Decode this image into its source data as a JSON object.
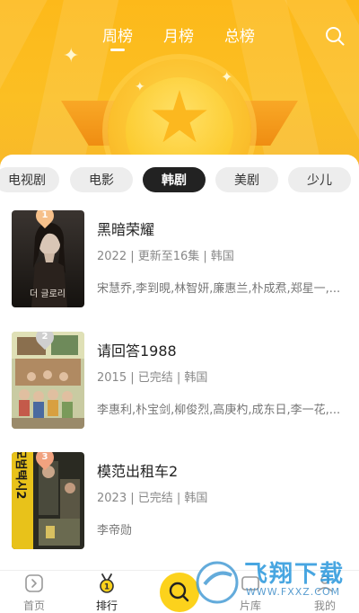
{
  "top_tabs": [
    {
      "label": "周榜",
      "active": true
    },
    {
      "label": "月榜",
      "active": false
    },
    {
      "label": "总榜",
      "active": false
    }
  ],
  "categories": [
    {
      "label": "电视剧",
      "active": false
    },
    {
      "label": "电影",
      "active": false
    },
    {
      "label": "韩剧",
      "active": true
    },
    {
      "label": "美剧",
      "active": false
    },
    {
      "label": "少儿",
      "active": false
    }
  ],
  "items": [
    {
      "rank": "1",
      "title": "黑暗荣耀",
      "meta": "2022 | 更新至16集 | 韩国",
      "cast": "宋慧乔,李到晛,林智妍,廉惠兰,朴成焄,郑星一,...",
      "poster_text": "더 글로리"
    },
    {
      "rank": "2",
      "title": "请回答1988",
      "meta": "2015 | 已完结 | 韩国",
      "cast": "李惠利,朴宝剑,柳俊烈,高庚杓,成东日,李一花,...",
      "poster_text": ""
    },
    {
      "rank": "3",
      "title": "模范出租车2",
      "meta": "2023 | 已完结 | 韩国",
      "cast": "李帝勋",
      "poster_text": "모범택시2"
    }
  ],
  "bottom_nav": [
    {
      "label": "首页",
      "icon": "home-icon",
      "active": false
    },
    {
      "label": "排行",
      "icon": "medal-icon",
      "active": true
    },
    {
      "label": "片库",
      "icon": "library-icon",
      "active": false
    },
    {
      "label": "我的",
      "icon": "profile-icon",
      "active": false
    }
  ],
  "watermark": {
    "title": "飞翔下载",
    "url": "WWW.FXXZ.COM"
  },
  "colors": {
    "brand_yellow": "#fcd21c",
    "header": "#fbbf23",
    "active_chip": "#222222"
  }
}
